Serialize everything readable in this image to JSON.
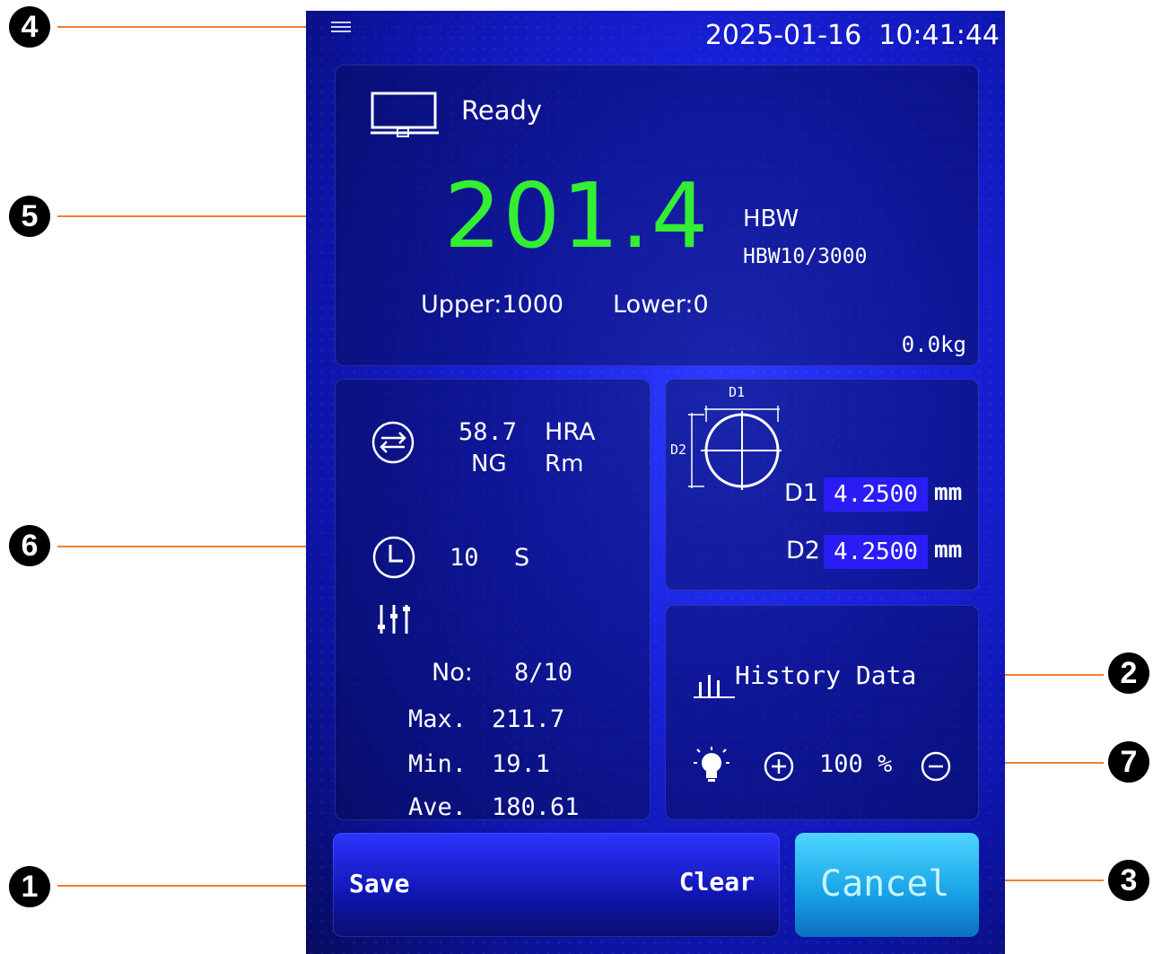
{
  "header": {
    "menu_icon": "hamburger-menu-icon",
    "datetime": "2025-01-16  10:41:44"
  },
  "status": {
    "icon": "monitor-icon",
    "label": "Ready",
    "reading": "201.4",
    "unit": "HBW",
    "scale": "HBW10/3000",
    "upper": "Upper:1000",
    "lower": "Lower:0",
    "force": "0.0kg"
  },
  "conversion": {
    "icon": "swap-icon",
    "value": "58.7",
    "unit": "HRA",
    "result": "NG",
    "type": "Rm"
  },
  "dwell": {
    "icon": "clock-icon",
    "value": "10",
    "unit": "S"
  },
  "stats": {
    "icon": "statistics-icon",
    "no_label": "No:",
    "no_value": "8/10",
    "max_label": "Max.",
    "max_value": "211.7",
    "min_label": "Min.",
    "min_value": "19.1",
    "ave_label": "Ave.",
    "ave_value": "180.61"
  },
  "measure": {
    "diagram_d1": "D1",
    "diagram_d2": "D2",
    "d1_label": "D1",
    "d1_value": "4.2500",
    "d1_unit": "mm",
    "d2_label": "D2",
    "d2_value": "4.2500",
    "d2_unit": "mm"
  },
  "history": {
    "icon": "bar-chart-icon",
    "label": "History Data"
  },
  "brightness": {
    "icon": "light-bulb-icon",
    "plus_icon": "plus-circle-icon",
    "value": "100 %",
    "minus_icon": "minus-circle-icon"
  },
  "actions": {
    "save": "Save",
    "clear": "Clear",
    "cancel": "Cancel"
  },
  "callouts": [
    "1",
    "2",
    "3",
    "4",
    "5",
    "6",
    "7"
  ]
}
